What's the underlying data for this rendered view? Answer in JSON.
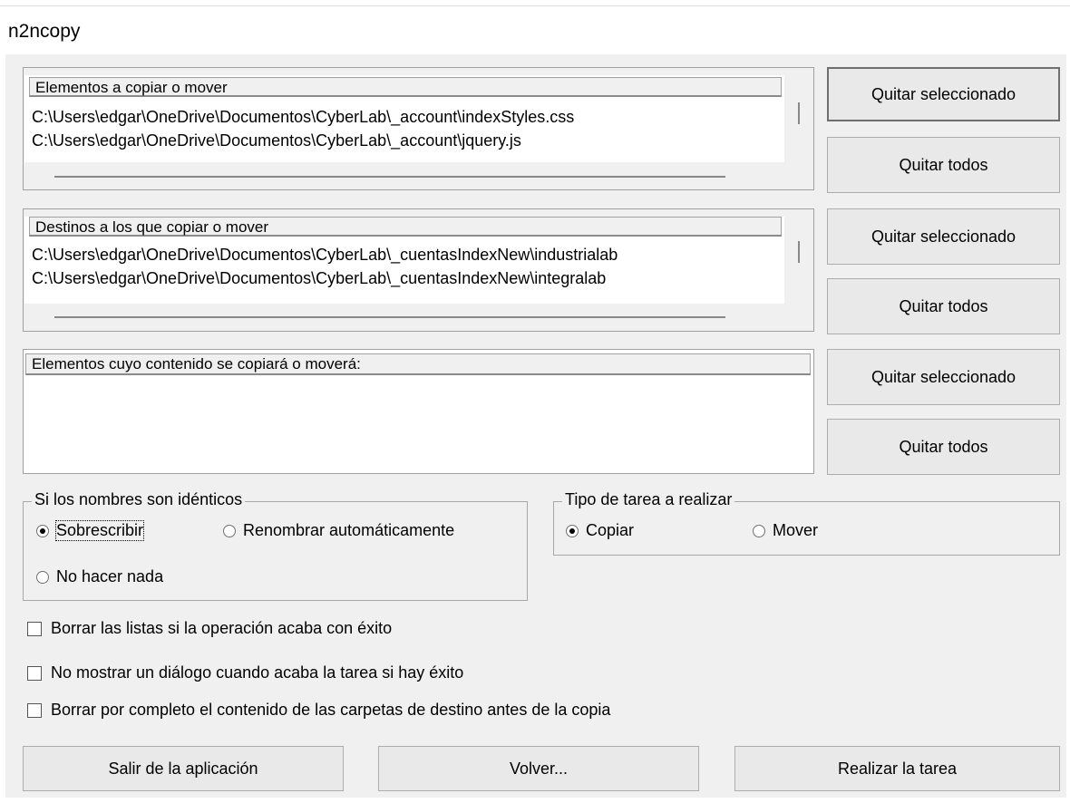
{
  "window": {
    "title": "n2ncopy"
  },
  "sources": {
    "header": "Elementos a copiar o mover",
    "items": [
      "C:\\Users\\edgar\\OneDrive\\Documentos\\CyberLab\\_account\\indexStyles.css",
      "C:\\Users\\edgar\\OneDrive\\Documentos\\CyberLab\\_account\\jquery.js"
    ],
    "remove_selected": "Quitar seleccionado",
    "remove_all": "Quitar todos"
  },
  "destinations": {
    "header": "Destinos a los que copiar o mover",
    "items": [
      "C:\\Users\\edgar\\OneDrive\\Documentos\\CyberLab\\_cuentasIndexNew\\industrialab",
      "C:\\Users\\edgar\\OneDrive\\Documentos\\CyberLab\\_cuentasIndexNew\\integralab"
    ],
    "remove_selected": "Quitar seleccionado",
    "remove_all": "Quitar todos"
  },
  "contents": {
    "header": "Elementos cuyo contenido se copiará o moverá:",
    "remove_selected": "Quitar seleccionado",
    "remove_all": "Quitar todos"
  },
  "identical_names": {
    "legend": "Si los nombres son idénticos",
    "overwrite": "Sobrescribir",
    "auto_rename": "Renombrar automáticamente",
    "do_nothing": "No hacer nada",
    "selected": "overwrite"
  },
  "task_type": {
    "legend": "Tipo de tarea a realizar",
    "copy": "Copiar",
    "move": "Mover",
    "selected": "copy"
  },
  "options": [
    {
      "label": "Borrar las listas si la operación acaba con éxito",
      "checked": false
    },
    {
      "label": "No mostrar un diálogo cuando acaba la tarea si hay éxito",
      "checked": false
    },
    {
      "label": "Borrar por completo el contenido de las carpetas de destino antes de la copia",
      "checked": false
    }
  ],
  "footer": {
    "exit": "Salir de la aplicación",
    "back": "Volver...",
    "run": "Realizar la tarea"
  }
}
